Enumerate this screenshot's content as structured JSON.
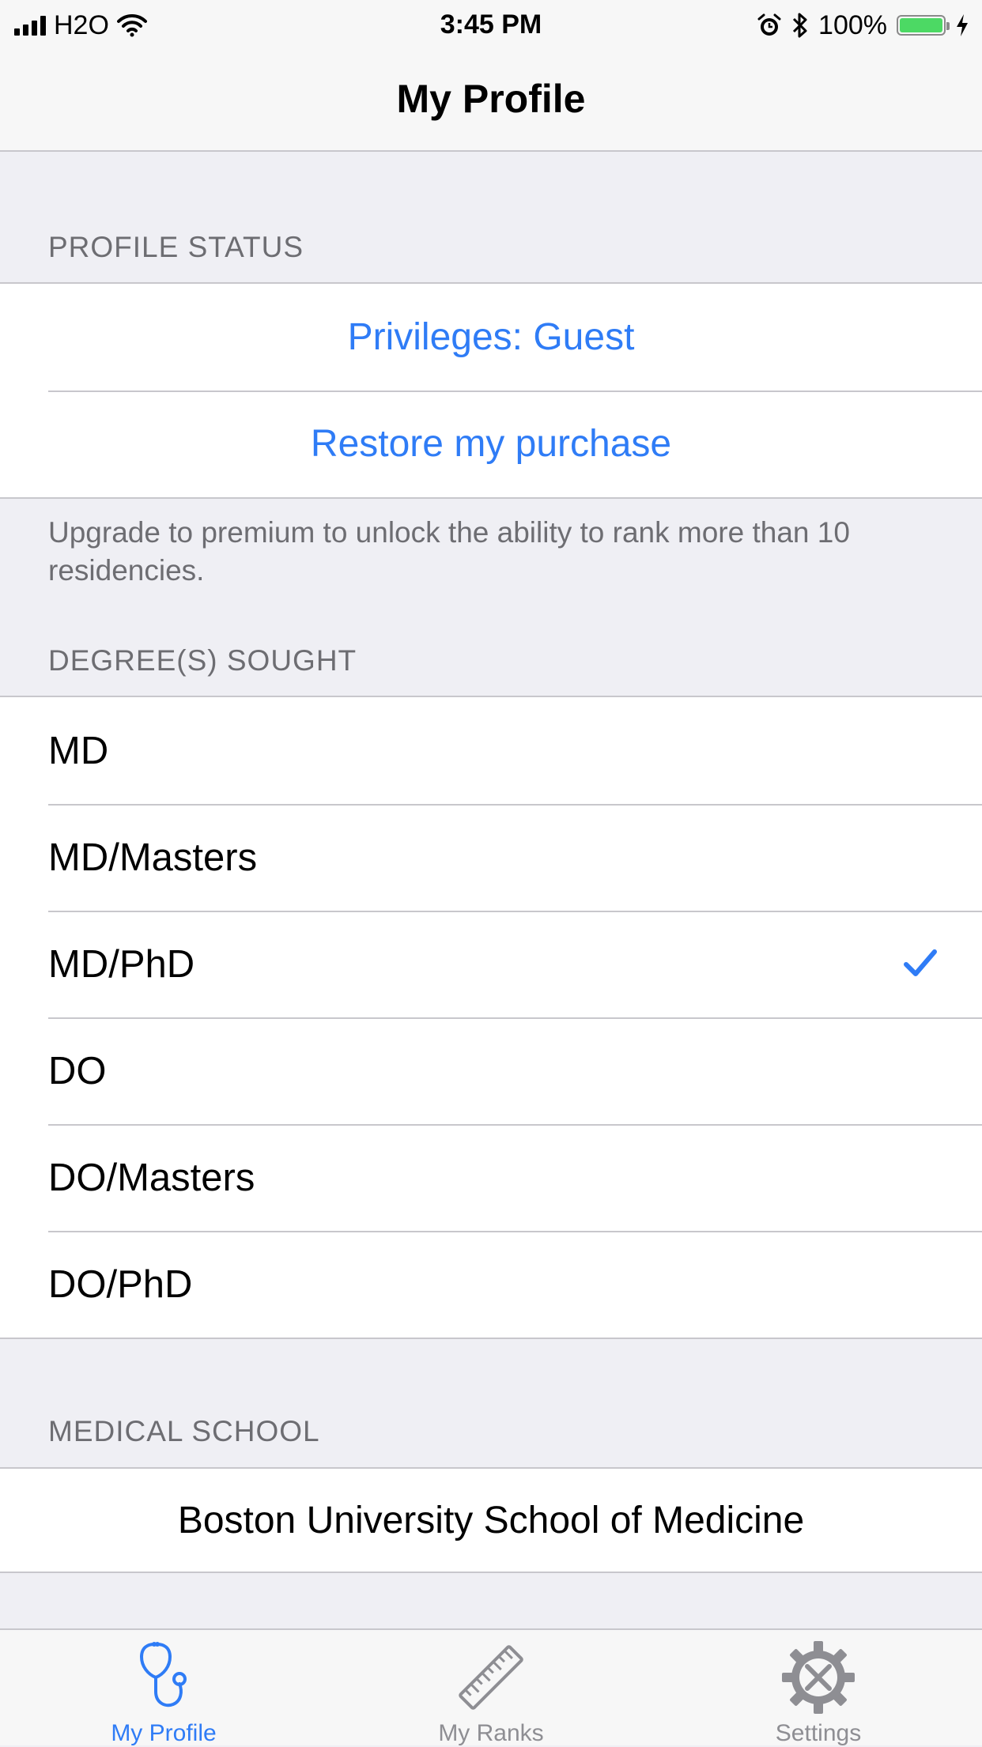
{
  "status_bar": {
    "carrier": "H2O",
    "time": "3:45 PM",
    "battery_percent": "100%",
    "battery_level": 1.0
  },
  "nav": {
    "title": "My Profile"
  },
  "profile_status": {
    "header": "PROFILE STATUS",
    "privileges_label": "Privileges: Guest",
    "restore_label": "Restore my purchase",
    "footer": "Upgrade to premium to unlock the ability to rank more than 10 residencies."
  },
  "degrees": {
    "header": "DEGREE(S) SOUGHT",
    "items": [
      {
        "label": "MD",
        "selected": false
      },
      {
        "label": "MD/Masters",
        "selected": false
      },
      {
        "label": "MD/PhD",
        "selected": true
      },
      {
        "label": "DO",
        "selected": false
      },
      {
        "label": "DO/Masters",
        "selected": false
      },
      {
        "label": "DO/PhD",
        "selected": false
      }
    ]
  },
  "medical_school": {
    "header": "MEDICAL SCHOOL",
    "value": "Boston University School of Medicine"
  },
  "tabs": [
    {
      "label": "My Profile",
      "icon": "stethoscope-icon",
      "active": true
    },
    {
      "label": "My Ranks",
      "icon": "ruler-icon",
      "active": false
    },
    {
      "label": "Settings",
      "icon": "settings-gear-icon",
      "active": false
    }
  ],
  "colors": {
    "accent": "#2f7cf6",
    "background": "#efeff4",
    "separator": "#c8c7cc",
    "battery": "#4cd964"
  }
}
